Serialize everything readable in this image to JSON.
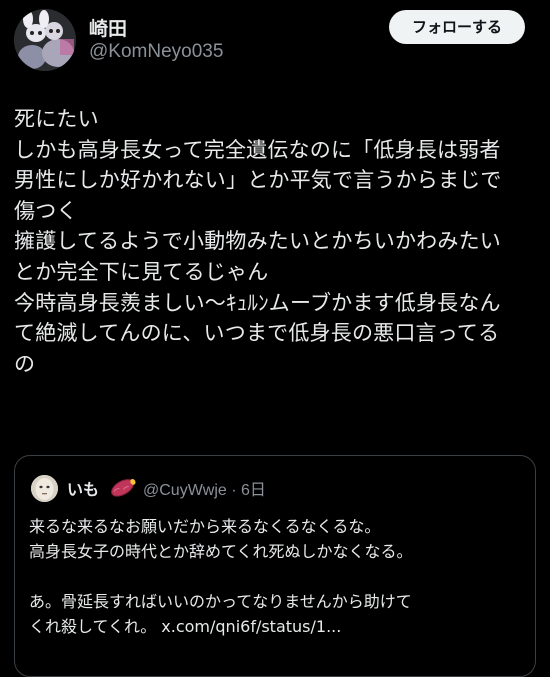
{
  "author": {
    "display_name": "崎田",
    "handle": "@KomNeyo035"
  },
  "follow_label": "フォローする",
  "post_lines": [
    "死にたい",
    "しかも高身長女って完全遺伝なのに「低身長は弱者",
    "男性にしか好かれない」とか平気で言うからまじで",
    "傷つく",
    "擁護してるようで小動物みたいとかちいかわみたい",
    "とか完全下に見てるじゃん",
    "今時高身長羨ましい〜ｷｭﾙﾝムーブかます低身長なん",
    "て絶滅してんのに、いつまで低身長の悪口言ってる",
    "の"
  ],
  "quote": {
    "display_name": "いも",
    "emoji": "sweet-potato",
    "handle_time": "@CuyWwje · 6日",
    "lines": [
      "来るな来るなお願いだから来るなくるなくるな。",
      "高身長女子の時代とか辞めてくれ死ぬしかなくなる。",
      "",
      "あ。骨延長すればいいのかってなりませんから助けて",
      "くれ殺してくれ。 x.com/qni6f/status/1..."
    ]
  }
}
